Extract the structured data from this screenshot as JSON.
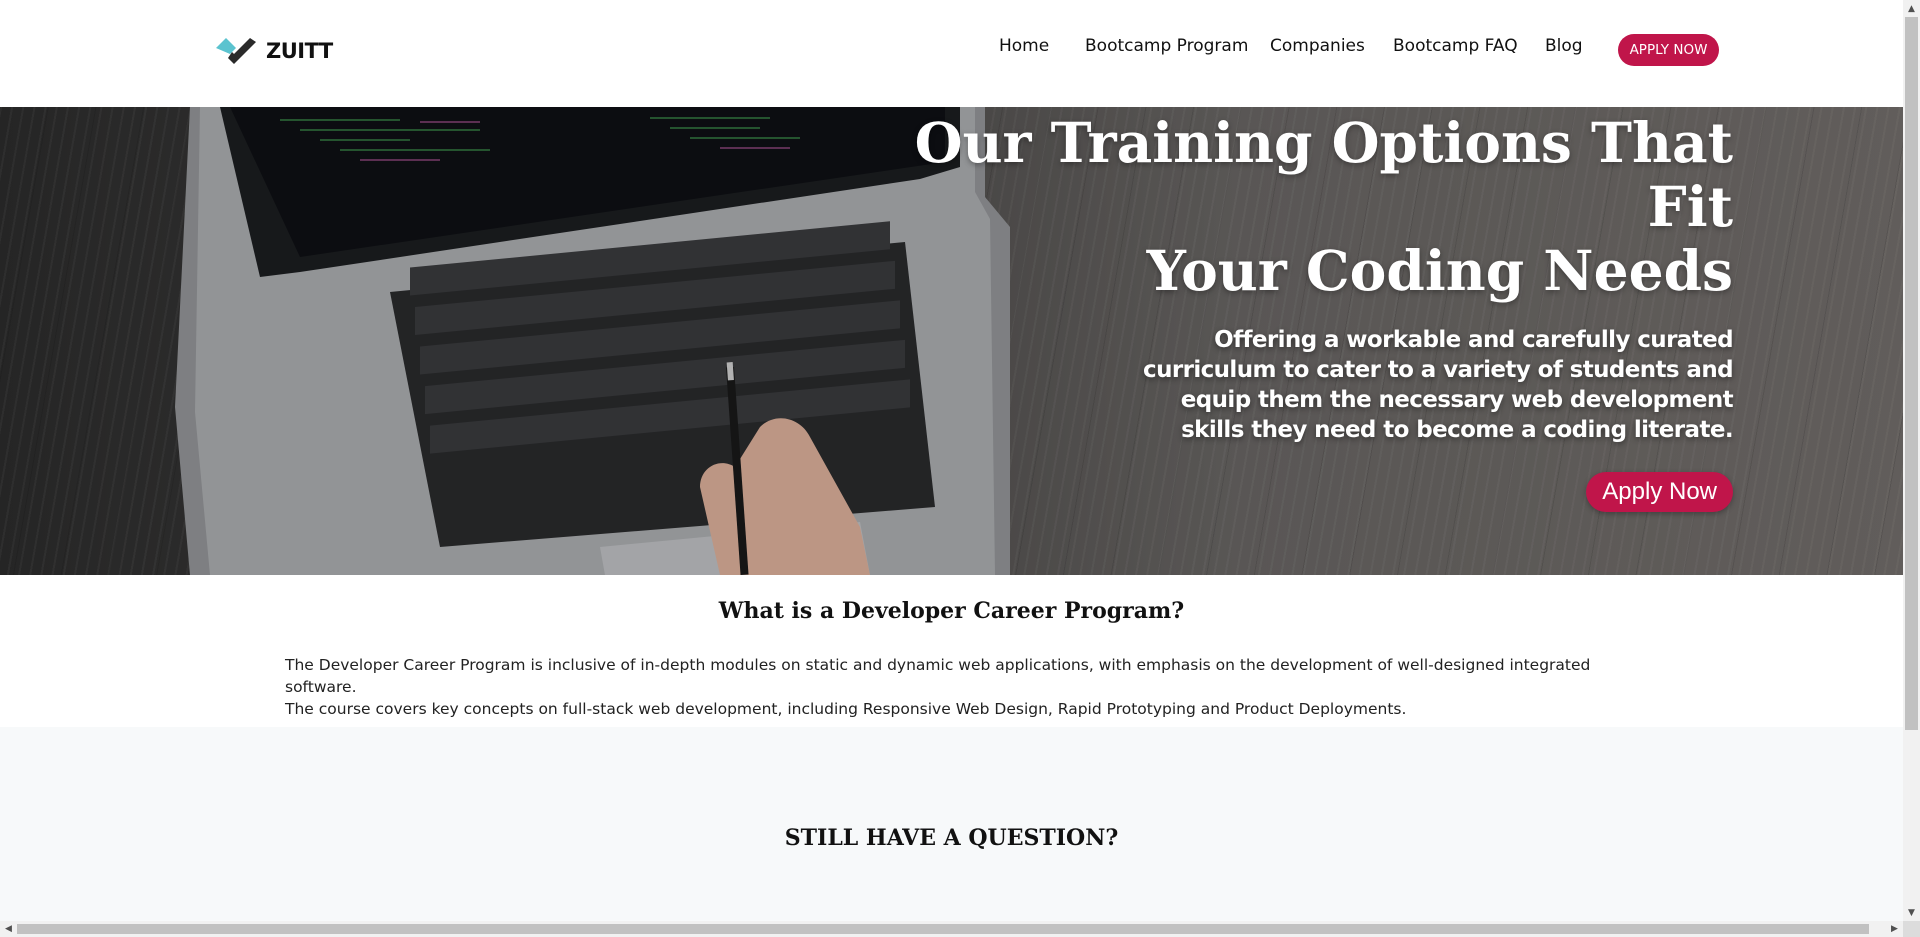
{
  "brand": {
    "name": "ZUITT",
    "accent": "#c0154a",
    "logo_icon": "zuitt-check-logo-icon"
  },
  "nav": {
    "items": [
      {
        "label": "Home"
      },
      {
        "label": "Bootcamp Program"
      },
      {
        "label": "Companies"
      },
      {
        "label": "Bootcamp FAQ"
      },
      {
        "label": "Blog"
      }
    ],
    "apply_label": "APPLY NOW"
  },
  "hero": {
    "title_line1": "Our Training Options That Fit",
    "title_line2": "Your Coding Needs",
    "subtitle": "Offering a workable and carefully curated curriculum to cater to a variety of students and equip them the necessary web development skills they need to become a coding literate.",
    "button_label": "Apply Now"
  },
  "program": {
    "title": "What is a Developer Career Program?",
    "line1": "The Developer Career Program is inclusive of in-depth modules on static and dynamic web applications, with emphasis on the development of well-designed integrated software.",
    "line2": "The course covers key concepts on full-stack web development, including Responsive Web Design, Rapid Prototyping and Product Deployments."
  },
  "question": {
    "title": "STILL HAVE A QUESTION?"
  }
}
